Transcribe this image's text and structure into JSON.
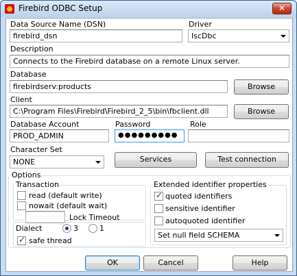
{
  "window": {
    "title": "Firebird ODBC Setup"
  },
  "fields": {
    "dsn_label": "Data Source Name (DSN)",
    "dsn_value": "firebird_dsn",
    "driver_label": "Driver",
    "driver_value": "IscDbc",
    "description_label": "Description",
    "description_value": "Connects to the Firebird database on a remote Linux server.",
    "database_label": "Database",
    "database_value": "firebirdserv:products",
    "client_label": "Client",
    "client_value": "C:\\Program Files\\Firebird\\Firebird_2_5\\bin\\fbclient.dll",
    "account_label": "Database Account",
    "account_value": "PROD_ADMIN",
    "password_label": "Password",
    "password_value": "●●●●●●●●●",
    "role_label": "Role",
    "role_value": "",
    "charset_label": "Character Set",
    "charset_value": "NONE"
  },
  "buttons": {
    "browse_db": "Browse",
    "browse_client": "Browse",
    "services": "Services",
    "test_connection": "Test connection",
    "ok": "OK",
    "cancel": "Cancel",
    "help": "Help"
  },
  "options": {
    "title": "Options",
    "transaction": {
      "title": "Transaction",
      "read": "read (default write)",
      "nowait": "nowait (default wait)",
      "lock_timeout_label": "Lock Timeout",
      "lock_timeout_value": ""
    },
    "dialect": {
      "title": "Dialect",
      "option_3": "3",
      "option_1": "1",
      "selected": "3"
    },
    "safe_thread": "safe thread",
    "extended": {
      "title": "Extended identifier properties",
      "quoted": "quoted identifiers",
      "sensitive": "sensitive identifier",
      "autoquoted": "autoquoted identifier",
      "null_field_value": "Set null field SCHEMA"
    }
  }
}
